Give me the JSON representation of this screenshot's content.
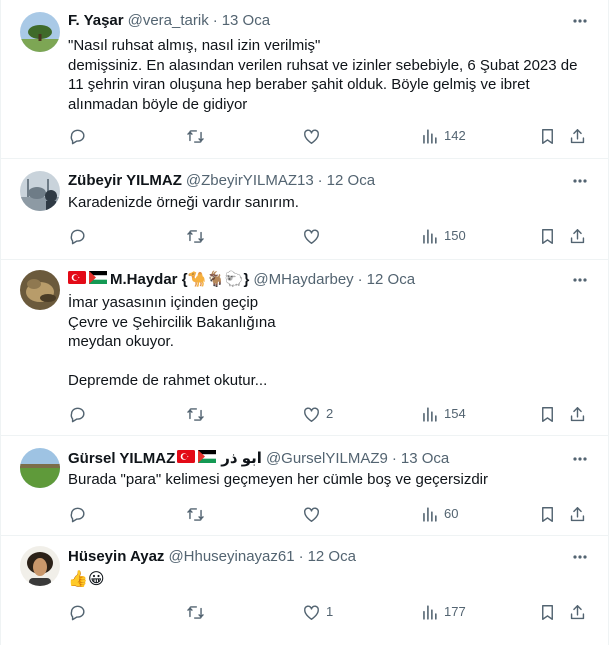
{
  "tweets": [
    {
      "name": "F. Yaşar",
      "handle": "@vera_tarik",
      "sep": "·",
      "time": "13 Oca",
      "text": "\"Nasıl ruhsat almış, nasıl izin verilmiş\"\ndemişsiniz. En alasından verilen ruhsat ve izinler sebebiyle, 6 Şubat 2023 de 11 şehrin viran oluşuna hep beraber şahit olduk. Böyle gelmiş ve ibret alınmadan böyle de gidiyor",
      "replies": "",
      "retweets": "",
      "likes": "",
      "views": "142"
    },
    {
      "name": "Zübeyir YILMAZ",
      "handle": "@ZbeyirYILMAZ13",
      "sep": "·",
      "time": "12 Oca",
      "text": "Karadenizde örneği vardır sanırım.",
      "replies": "",
      "retweets": "",
      "likes": "",
      "views": "150"
    },
    {
      "name": "M.Haydar {🐪🐐🐑}",
      "handle": "@MHaydarbey",
      "sep": "·",
      "time": "12 Oca",
      "text": "İmar yasasının içinden geçip\nÇevre ve Şehircilik Bakanlığına\nmeydan okuyor.\n\nDepremde de rahmet okutur...",
      "replies": "",
      "retweets": "",
      "likes": "2",
      "views": "154"
    },
    {
      "name": "Gürsel YILMAZ",
      "name_suffix": "ابو ذر",
      "handle": "@GurselYILMAZ9",
      "sep": "·",
      "time": "13 Oca",
      "text": "Burada \"para\" kelimesi geçmeyen her cümle boş ve geçersizdir",
      "replies": "",
      "retweets": "",
      "likes": "",
      "views": "60"
    },
    {
      "name": "Hüseyin Ayaz",
      "handle": "@Hhuseyinayaz61",
      "sep": "·",
      "time": "12 Oca",
      "text": "👍😀",
      "replies": "",
      "retweets": "",
      "likes": "1",
      "views": "177"
    }
  ],
  "colors": {
    "text": "#0f1419",
    "secondary": "#536471",
    "divider": "#eff3f4",
    "turkey_red": "#e30a17",
    "palestine_green": "#149954"
  },
  "icons": [
    "reply-icon",
    "retweet-icon",
    "like-icon",
    "views-icon",
    "bookmark-icon",
    "share-icon",
    "more-icon"
  ]
}
